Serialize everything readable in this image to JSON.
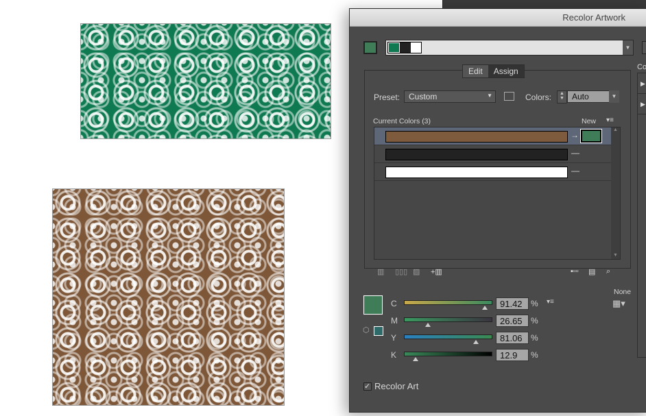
{
  "dialog": {
    "title": "Recolor Artwork",
    "tabs": [
      {
        "label": "Edit"
      },
      {
        "label": "Assign"
      }
    ],
    "preset": {
      "label": "Preset:",
      "value": "Custom"
    },
    "colors": {
      "label": "Colors:",
      "value": "Auto"
    },
    "list": {
      "header": "Current Colors (3)",
      "new_label": "New",
      "rows": [
        {
          "current": "#7d5b3c",
          "new": "#3f7d58",
          "selected": true
        },
        {
          "current": "#222222",
          "new": null
        },
        {
          "current": "#ffffff",
          "new": null
        }
      ]
    },
    "group_colors": [
      "#0f7a52",
      "#222222",
      "#ffffff"
    ],
    "active_color": "#3f7d58",
    "none_label": "None",
    "cmyk": [
      {
        "label": "C",
        "value": "91.42",
        "level": 91.42
      },
      {
        "label": "M",
        "value": "26.65",
        "level": 26.65
      },
      {
        "label": "Y",
        "value": "81.06",
        "level": 81.06
      },
      {
        "label": "K",
        "value": "12.9",
        "level": 12.9
      }
    ],
    "percent": "%",
    "recolor_art": {
      "label": "Recolor Art",
      "checked": true
    },
    "side_label": "Co"
  }
}
